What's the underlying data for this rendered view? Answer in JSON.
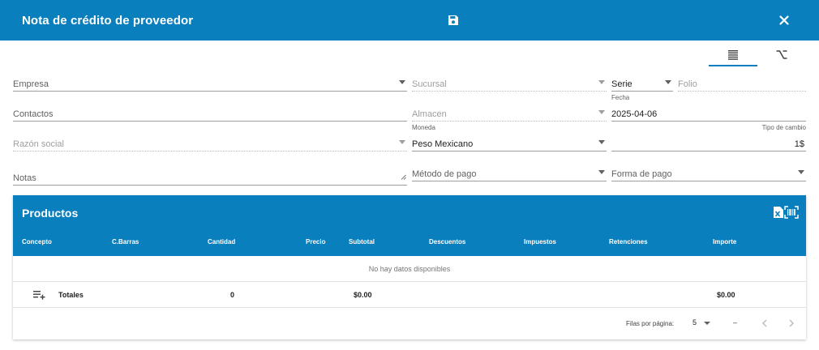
{
  "header": {
    "title": "Nota de crédito de proveedor",
    "save_icon": "save-icon",
    "close_icon": "close-icon",
    "background": "#0a7fbd"
  },
  "view_tabs": [
    {
      "icon": "list-icon",
      "active": true
    },
    {
      "icon": "option-key-icon",
      "active": false
    }
  ],
  "form": {
    "empresa": {
      "placeholder": "Empresa",
      "value": ""
    },
    "sucursal": {
      "placeholder": "Sucursal",
      "value": "",
      "disabled": true
    },
    "serie": {
      "value": "Serie"
    },
    "folio": {
      "placeholder": "Folio",
      "value": "",
      "disabled": true
    },
    "contactos": {
      "placeholder": "Contactos",
      "value": ""
    },
    "almacen": {
      "placeholder": "Almacen",
      "value": "",
      "disabled": true
    },
    "fecha": {
      "label": "Fecha",
      "value": "2025-04-06"
    },
    "razon_social": {
      "placeholder": "Razón social",
      "value": "",
      "disabled": true
    },
    "moneda": {
      "label": "Moneda",
      "value": "Peso Mexicano"
    },
    "tipo_cambio": {
      "label": "Tipo de cambio",
      "value": "1$"
    },
    "notas": {
      "placeholder": "Notas",
      "value": ""
    },
    "metodo_pago": {
      "placeholder": "Método de pago",
      "value": ""
    },
    "forma_pago": {
      "placeholder": "Forma de pago",
      "value": ""
    }
  },
  "products": {
    "title": "Productos",
    "tools": [
      "excel-icon",
      "barcode-scan-icon"
    ],
    "columns": [
      "Concepto",
      "C.Barras",
      "Cantidad",
      "Precio",
      "Subtotal",
      "Descuentos",
      "Impuestos",
      "Retenciones",
      "Importe"
    ],
    "empty_message": "No hay datos disponibles",
    "totals": {
      "label": "Totales",
      "cantidad": "0",
      "subtotal": "$0.00",
      "importe": "$0.00"
    },
    "pagination": {
      "rows_label": "Filas por página:",
      "rows_value": "5",
      "range": "–"
    }
  }
}
